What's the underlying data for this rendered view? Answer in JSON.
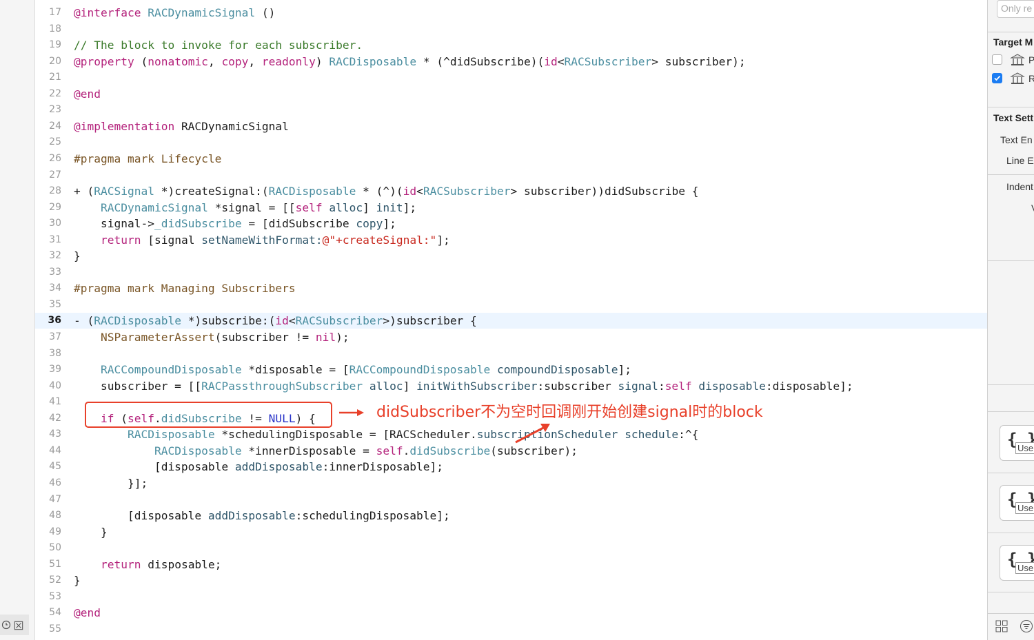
{
  "editor": {
    "current_line": "36",
    "lines": [
      {
        "n": "17",
        "t": [
          [
            "@interface ",
            "kw"
          ],
          [
            "RACDynamicSignal",
            "cls"
          ],
          [
            " ()",
            "pl"
          ]
        ]
      },
      {
        "n": "18",
        "t": []
      },
      {
        "n": "19",
        "t": [
          [
            "// The block to invoke for each subscriber.",
            "cm"
          ]
        ]
      },
      {
        "n": "20",
        "t": [
          [
            "@property ",
            "kw"
          ],
          [
            "(",
            "pl"
          ],
          [
            "nonatomic",
            "kw"
          ],
          [
            ", ",
            "pl"
          ],
          [
            "copy",
            "kw"
          ],
          [
            ", ",
            "pl"
          ],
          [
            "readonly",
            "kw"
          ],
          [
            ") ",
            "pl"
          ],
          [
            "RACDisposable",
            "cls"
          ],
          [
            " * (^didSubscribe)(",
            "pl"
          ],
          [
            "id",
            "kw"
          ],
          [
            "<",
            "pl"
          ],
          [
            "RACSubscriber",
            "cls"
          ],
          [
            "> subscriber);",
            "pl"
          ]
        ]
      },
      {
        "n": "21",
        "t": []
      },
      {
        "n": "22",
        "t": [
          [
            "@end",
            "kw"
          ]
        ]
      },
      {
        "n": "23",
        "t": []
      },
      {
        "n": "24",
        "t": [
          [
            "@implementation ",
            "kw"
          ],
          [
            "RACDynamicSignal",
            "pl"
          ]
        ]
      },
      {
        "n": "25",
        "t": []
      },
      {
        "n": "26",
        "t": [
          [
            "#pragma mark Lifecycle",
            "pp"
          ]
        ]
      },
      {
        "n": "27",
        "t": []
      },
      {
        "n": "28",
        "t": [
          [
            "+ (",
            "pl"
          ],
          [
            "RACSignal",
            "cls"
          ],
          [
            " *)createSignal:(",
            "pl"
          ],
          [
            "RACDisposable",
            "cls"
          ],
          [
            " * (^)(",
            "pl"
          ],
          [
            "id",
            "kw"
          ],
          [
            "<",
            "pl"
          ],
          [
            "RACSubscriber",
            "cls"
          ],
          [
            "> subscriber))didSubscribe {",
            "pl"
          ]
        ]
      },
      {
        "n": "29",
        "t": [
          [
            "    ",
            "pl"
          ],
          [
            "RACDynamicSignal",
            "cls"
          ],
          [
            " *signal = [[",
            "pl"
          ],
          [
            "self",
            "kw"
          ],
          [
            " ",
            "pl"
          ],
          [
            "alloc",
            "nm"
          ],
          [
            "] ",
            "pl"
          ],
          [
            "init",
            "nm"
          ],
          [
            "];",
            "pl"
          ]
        ]
      },
      {
        "n": "30",
        "t": [
          [
            "    signal->",
            "pl"
          ],
          [
            "_didSubscribe",
            "cls"
          ],
          [
            " = [didSubscribe ",
            "pl"
          ],
          [
            "copy",
            "nm"
          ],
          [
            "];",
            "pl"
          ]
        ]
      },
      {
        "n": "31",
        "t": [
          [
            "    ",
            "pl"
          ],
          [
            "return",
            "kw"
          ],
          [
            " [signal ",
            "pl"
          ],
          [
            "setNameWithFormat:",
            "nm"
          ],
          [
            "@\"+createSignal:\"",
            "str"
          ],
          [
            "];",
            "pl"
          ]
        ]
      },
      {
        "n": "32",
        "t": [
          [
            "}",
            "pl"
          ]
        ]
      },
      {
        "n": "33",
        "t": []
      },
      {
        "n": "34",
        "t": [
          [
            "#pragma mark Managing Subscribers",
            "pp"
          ]
        ]
      },
      {
        "n": "35",
        "t": []
      },
      {
        "n": "36",
        "t": [
          [
            "- (",
            "pl"
          ],
          [
            "RACDisposable",
            "cls"
          ],
          [
            " *)subscribe:(",
            "pl"
          ],
          [
            "id",
            "kw"
          ],
          [
            "<",
            "pl"
          ],
          [
            "RACSubscriber",
            "cls"
          ],
          [
            ">)subscriber {",
            "pl"
          ]
        ]
      },
      {
        "n": "37",
        "t": [
          [
            "    ",
            "pl"
          ],
          [
            "NSParameterAssert",
            "pp"
          ],
          [
            "(subscriber != ",
            "pl"
          ],
          [
            "nil",
            "kw"
          ],
          [
            ");",
            "pl"
          ]
        ]
      },
      {
        "n": "38",
        "t": []
      },
      {
        "n": "39",
        "t": [
          [
            "    ",
            "pl"
          ],
          [
            "RACCompoundDisposable",
            "cls"
          ],
          [
            " *disposable = [",
            "pl"
          ],
          [
            "RACCompoundDisposable",
            "cls"
          ],
          [
            " ",
            "pl"
          ],
          [
            "compoundDisposable",
            "nm"
          ],
          [
            "];",
            "pl"
          ]
        ]
      },
      {
        "n": "40",
        "t": [
          [
            "    subscriber = [[",
            "pl"
          ],
          [
            "RACPassthroughSubscriber",
            "cls"
          ],
          [
            " ",
            "pl"
          ],
          [
            "alloc",
            "nm"
          ],
          [
            "] ",
            "pl"
          ],
          [
            "initWithSubscriber",
            "nm"
          ],
          [
            ":subscriber ",
            "pl"
          ],
          [
            "signal",
            "nm"
          ],
          [
            ":",
            "pl"
          ],
          [
            "self",
            "kw"
          ],
          [
            " ",
            "pl"
          ],
          [
            "disposable",
            "nm"
          ],
          [
            ":disposable];",
            "pl"
          ]
        ]
      },
      {
        "n": "41",
        "t": []
      },
      {
        "n": "42",
        "t": [
          [
            "    ",
            "pl"
          ],
          [
            "if",
            "kw"
          ],
          [
            " (",
            "pl"
          ],
          [
            "self",
            "kw"
          ],
          [
            ".",
            "pl"
          ],
          [
            "didSubscribe",
            "cls"
          ],
          [
            " != ",
            "pl"
          ],
          [
            "NULL",
            "nu"
          ],
          [
            ") {",
            "pl"
          ]
        ]
      },
      {
        "n": "43",
        "t": [
          [
            "        ",
            "pl"
          ],
          [
            "RACDisposable",
            "cls"
          ],
          [
            " *schedulingDisposable = [RACScheduler.",
            "pl"
          ],
          [
            "subscriptionScheduler",
            "nm"
          ],
          [
            " ",
            "pl"
          ],
          [
            "schedule",
            "nm"
          ],
          [
            ":^{",
            "pl"
          ]
        ]
      },
      {
        "n": "44",
        "t": [
          [
            "            ",
            "pl"
          ],
          [
            "RACDisposable",
            "cls"
          ],
          [
            " *innerDisposable = ",
            "pl"
          ],
          [
            "self",
            "kw"
          ],
          [
            ".",
            "pl"
          ],
          [
            "didSubscribe",
            "cls"
          ],
          [
            "(subscriber);",
            "pl"
          ]
        ]
      },
      {
        "n": "45",
        "t": [
          [
            "            [disposable ",
            "pl"
          ],
          [
            "addDisposable",
            "nm"
          ],
          [
            ":innerDisposable];",
            "pl"
          ]
        ]
      },
      {
        "n": "46",
        "t": [
          [
            "        }];",
            "pl"
          ]
        ]
      },
      {
        "n": "47",
        "t": []
      },
      {
        "n": "48",
        "t": [
          [
            "        [disposable ",
            "pl"
          ],
          [
            "addDisposable",
            "nm"
          ],
          [
            ":schedulingDisposable];",
            "pl"
          ]
        ]
      },
      {
        "n": "49",
        "t": [
          [
            "    }",
            "pl"
          ]
        ]
      },
      {
        "n": "50",
        "t": []
      },
      {
        "n": "51",
        "t": [
          [
            "    ",
            "pl"
          ],
          [
            "return",
            "kw"
          ],
          [
            " disposable;",
            "pl"
          ]
        ]
      },
      {
        "n": "52",
        "t": [
          [
            "}",
            "pl"
          ]
        ]
      },
      {
        "n": "53",
        "t": []
      },
      {
        "n": "54",
        "t": [
          [
            "@end",
            "kw"
          ]
        ]
      },
      {
        "n": "55",
        "t": []
      }
    ]
  },
  "annotation": {
    "text": "didSubscriber不为空时回调刚开始创建signal时的block",
    "color": "#e8402a"
  },
  "right_panel": {
    "search_placeholder": "Only re",
    "target_header": "Target M",
    "target_items": [
      {
        "checked": false,
        "label": "P"
      },
      {
        "checked": true,
        "label": "R"
      }
    ],
    "text_settings_header": "Text Sett",
    "text_encoding_label": "Text En",
    "line_endings_label": "Line E",
    "indent_label": "Indent",
    "indent_sub": "V",
    "snippet_tag": "Use",
    "snippets": [
      "{ }",
      "{ }",
      "{ }"
    ]
  },
  "colors": {
    "keyword": "#b4237c",
    "class": "#4b8ea0",
    "comment": "#3a7a2a",
    "string": "#c8281e",
    "current_line_bg": "#ecf5ff"
  }
}
